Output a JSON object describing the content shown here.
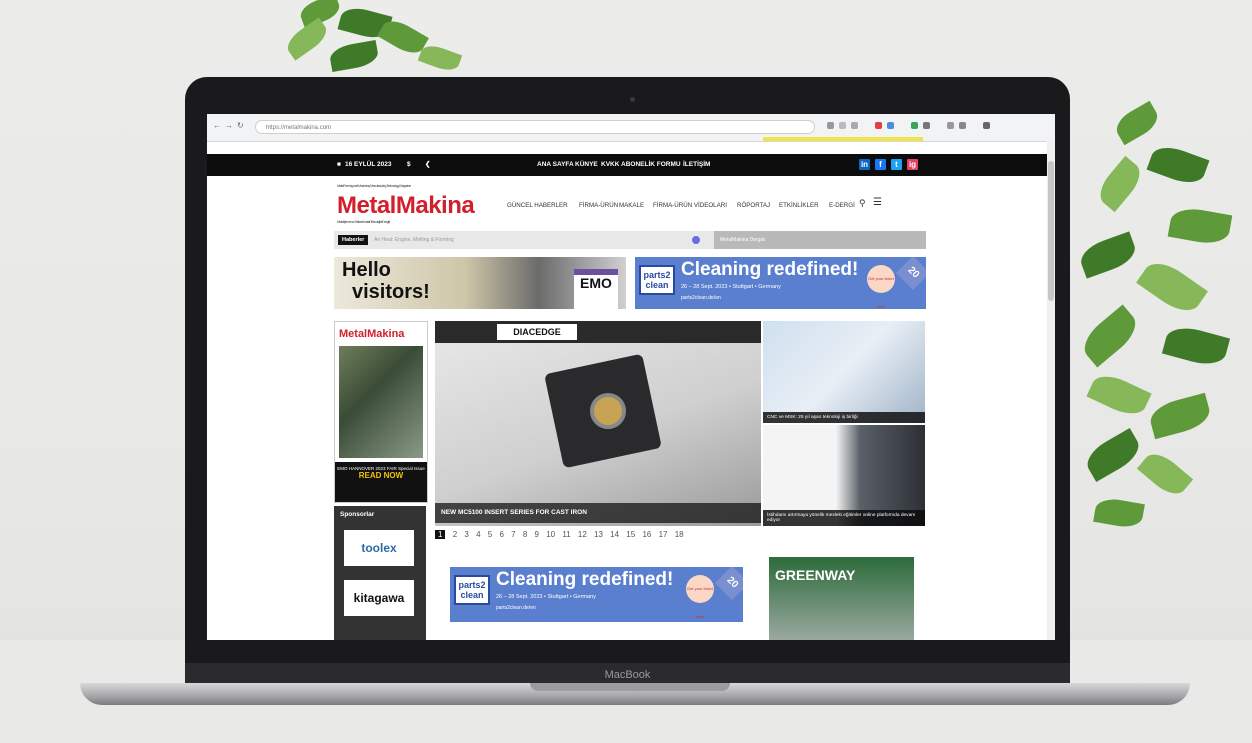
{
  "device": {
    "label": "MacBook"
  },
  "browser": {
    "url": "https://metalmakina.com"
  },
  "topbar": {
    "date": "16 EYLÜL 2023",
    "currency": "$",
    "links": [
      "ANA SAYFA",
      "KÜNYE",
      "KVKK",
      "ABONELİK FORMU",
      "İLETİŞİM"
    ],
    "social": [
      "in",
      "f",
      "t",
      "ig"
    ]
  },
  "site": {
    "logo": "MetalMakina",
    "tagline": "Metal Forming and Machinery Manufacturing Technology Magazine",
    "subtagline": "Metal İşleme ve Makina İmalat Teknolojileri Dergisi",
    "menu": [
      "GÜNCEL HABERLER",
      "FİRMA-ÜRÜN",
      "MAKALE",
      "FİRMA-ÜRÜN VİDEOLARI",
      "RÖPORTAJ",
      "ETKİNLİKLER",
      "E-DERGİ"
    ]
  },
  "ticker": {
    "label": "Haberler",
    "text": "Air Heat: Engine, Melting & Forming",
    "right": "MetalMakina Dergisi"
  },
  "banners": {
    "hello": {
      "line1": "Hello",
      "line2": "visitors!",
      "emo": "EMO"
    },
    "parts2clean": {
      "box": "parts2 clean",
      "headline": "Cleaning redefined!",
      "details": "26 – 28 Sept. 2023 • Stuttgart • Germany",
      "url": "parts2clean.de/en",
      "badge": "Get your ticket now!",
      "anniv": "20"
    }
  },
  "magazine": {
    "title": "MetalMakina",
    "caption": "EMO HANNOVER 2023 FAIR Special Issue",
    "cta": "READ NOW"
  },
  "sponsors": {
    "heading": "Sponsorlar",
    "items": [
      "toolex",
      "kitagawa"
    ]
  },
  "hero": {
    "brand": "DIACEDGE",
    "caption": "NEW MC5100 INSERT SERIES FOR CAST IRON",
    "pages": [
      "1",
      "2",
      "3",
      "4",
      "5",
      "6",
      "7",
      "8",
      "9",
      "10",
      "11",
      "12",
      "13",
      "14",
      "15",
      "16",
      "17",
      "18"
    ]
  },
  "side_news": [
    {
      "caption": "CNC ve MSK: 25 yıl aşan teknoloji iş birliği"
    },
    {
      "caption": "İstihdamı artırmaya yönelik mesleki eğitimler online platformda devam ediyor"
    }
  ],
  "greenway": {
    "text": "GREENWAY"
  }
}
